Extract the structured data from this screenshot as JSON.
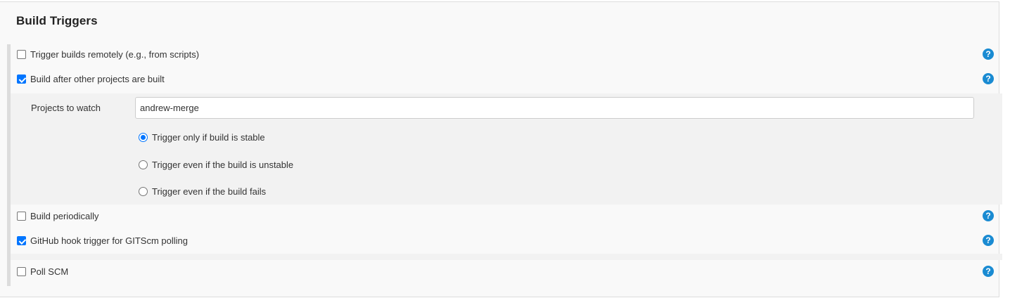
{
  "section": {
    "title": "Build Triggers"
  },
  "triggers": [
    {
      "label": "Trigger builds remotely (e.g., from scripts)",
      "checked": false
    },
    {
      "label": "Build after other projects are built",
      "checked": true
    },
    {
      "label": "Build periodically",
      "checked": false
    },
    {
      "label": "GitHub hook trigger for GITScm polling",
      "checked": true
    },
    {
      "label": "Poll SCM",
      "checked": false
    }
  ],
  "upstream": {
    "projects_label": "Projects to watch",
    "projects_value": "andrew-merge",
    "options": [
      {
        "label": "Trigger only if build is stable",
        "selected": true
      },
      {
        "label": "Trigger even if the build is unstable",
        "selected": false
      },
      {
        "label": "Trigger even if the build fails",
        "selected": false
      }
    ]
  },
  "help": {
    "glyph": "?"
  },
  "colors": {
    "accent": "#0075ff",
    "help": "#1a8bd2",
    "panel": "#f9f9f9",
    "nested": "#f2f2f2"
  }
}
